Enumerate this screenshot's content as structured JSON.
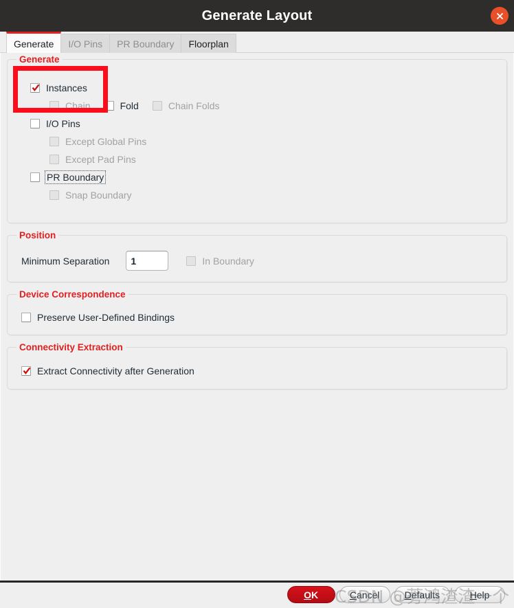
{
  "window": {
    "title": "Generate Layout",
    "close_icon": "close-circle-icon",
    "accent_red": "#e02020",
    "titlebar_bg": "#2e2d2c",
    "close_bg": "#e8502a"
  },
  "tabs": [
    {
      "label": "Generate",
      "state": "active"
    },
    {
      "label": "I/O Pins",
      "state": "disabled"
    },
    {
      "label": "PR Boundary",
      "state": "disabled"
    },
    {
      "label": "Floorplan",
      "state": "enabled"
    }
  ],
  "groups": {
    "generate": {
      "title": "Generate",
      "options": [
        {
          "label": "Instances",
          "checked": true,
          "enabled": true,
          "indent": 0,
          "focus": false
        },
        {
          "label": "Chain",
          "checked": false,
          "enabled": false,
          "indent": 1,
          "focus": false
        },
        {
          "label": "Fold",
          "checked": false,
          "enabled": true,
          "indent": 1,
          "focus": false
        },
        {
          "label": "Chain Folds",
          "checked": false,
          "enabled": false,
          "indent": 1,
          "focus": false
        },
        {
          "label": "I/O Pins",
          "checked": false,
          "enabled": true,
          "indent": 0,
          "focus": false
        },
        {
          "label": "Except Global Pins",
          "checked": false,
          "enabled": false,
          "indent": 1,
          "focus": false
        },
        {
          "label": "Except Pad Pins",
          "checked": false,
          "enabled": false,
          "indent": 1,
          "focus": false
        },
        {
          "label": "PR Boundary",
          "checked": false,
          "enabled": true,
          "indent": 0,
          "focus": true
        },
        {
          "label": "Snap Boundary",
          "checked": false,
          "enabled": false,
          "indent": 1,
          "focus": false
        }
      ]
    },
    "position": {
      "title": "Position",
      "min_separation_label": "Minimum Separation",
      "min_separation_value": "1",
      "min_separation_placeholder": "",
      "in_boundary_label": "In Boundary",
      "in_boundary_checked": false,
      "in_boundary_enabled": false
    },
    "device_correspondence": {
      "title": "Device Correspondence",
      "preserve_label": "Preserve User-Defined Bindings",
      "preserve_checked": false,
      "preserve_enabled": true
    },
    "connectivity_extraction": {
      "title": "Connectivity Extraction",
      "extract_label": "Extract Connectivity after Generation",
      "extract_checked": true,
      "extract_enabled": true
    }
  },
  "buttons": {
    "ok": "OK",
    "ok_mnemonic": "O",
    "cancel": "Cancel",
    "cancel_mnemonic": "C",
    "defaults": "Defaults",
    "defaults_mnemonic": "D",
    "help": "Help",
    "help_mnemonic": "H"
  },
  "annotation": {
    "shape": "rectangle",
    "color": "#fb0d1b",
    "highlights": "Instances checkbox"
  },
  "watermark": {
    "text": "CSDN @蒡鸿渣渣一个"
  }
}
